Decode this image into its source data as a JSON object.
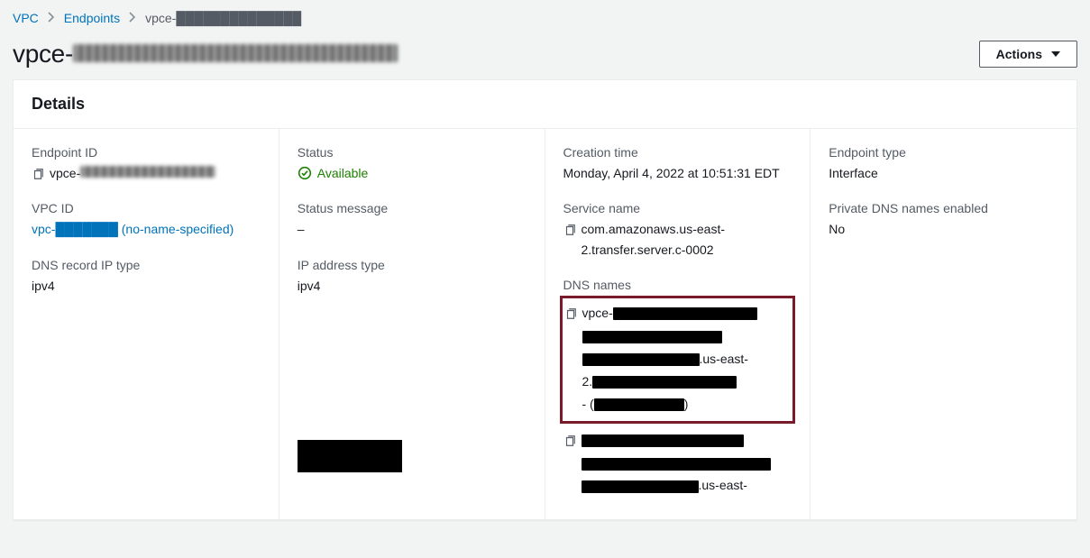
{
  "breadcrumb": {
    "root": "VPC",
    "section": "Endpoints",
    "current": "vpce-██████████████"
  },
  "page_title_prefix": "vpce-",
  "actions_label": "Actions",
  "details": {
    "heading": "Details",
    "endpoint_id_label": "Endpoint ID",
    "endpoint_id_prefix": "vpce-",
    "vpc_id_label": "VPC ID",
    "vpc_id_value": "vpc-███████ (no-name-specified)",
    "dns_ip_type_label": "DNS record IP type",
    "dns_ip_type_value": "ipv4",
    "status_label": "Status",
    "status_value": "Available",
    "status_msg_label": "Status message",
    "status_msg_value": "–",
    "ip_type_label": "IP address type",
    "ip_type_value": "ipv4",
    "creation_label": "Creation time",
    "creation_value": "Monday, April 4, 2022 at 10:51:31 EDT",
    "service_label": "Service name",
    "service_value": "com.amazonaws.us-east-2.transfer.server.c-0002",
    "dns_names_label": "DNS names",
    "dns_region_fragment": ".us-east-",
    "dns_prefix_2": "2.",
    "dns_dash": "- (",
    "dns_close_paren": ")",
    "endpoint_type_label": "Endpoint type",
    "endpoint_type_value": "Interface",
    "pdns_label": "Private DNS names enabled",
    "pdns_value": "No"
  }
}
